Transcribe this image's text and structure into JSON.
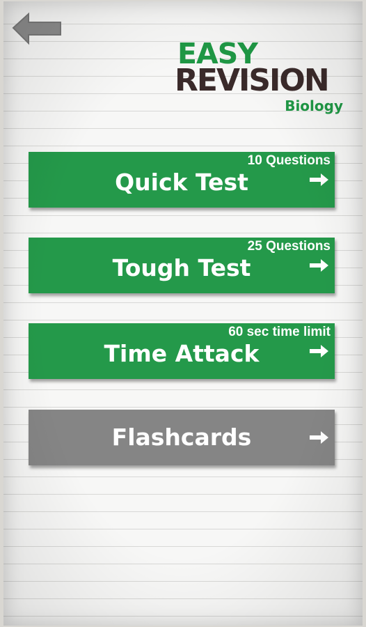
{
  "header": {
    "back_icon": "back-arrow-icon"
  },
  "logo": {
    "line1": "EASY",
    "line2": "REVISION",
    "subject": "Biology"
  },
  "menu": {
    "quick_test": {
      "label": "Quick Test",
      "sub": "10 Questions"
    },
    "tough_test": {
      "label": "Tough Test",
      "sub": "25 Questions"
    },
    "time_attack": {
      "label": "Time Attack",
      "sub": "60 sec time limit"
    },
    "flashcards": {
      "label": "Flashcards",
      "sub": ""
    }
  },
  "colors": {
    "green": "#24994a",
    "gray": "#858585",
    "logo_dark": "#3a2a2a"
  }
}
